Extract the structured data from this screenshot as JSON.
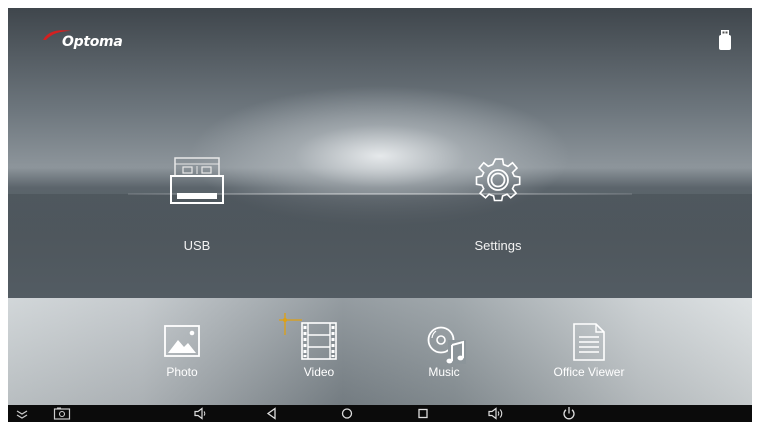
{
  "brand": {
    "logo_text": "Optoma",
    "accent": "#d42020"
  },
  "status": {
    "icon": "usb-drive-icon"
  },
  "main_apps": [
    {
      "label": "USB",
      "icon": "usb-drive-icon"
    },
    {
      "label": "Settings",
      "icon": "gear-icon"
    }
  ],
  "media_apps": [
    {
      "label": "Photo",
      "icon": "photo-icon"
    },
    {
      "label": "Video",
      "icon": "film-strip-icon"
    },
    {
      "label": "Music",
      "icon": "music-disc-icon"
    },
    {
      "label": "Office Viewer",
      "icon": "document-icon"
    }
  ],
  "navbar": {
    "background": "#0b0b0b",
    "buttons": [
      "collapse-icon",
      "screenshot-icon",
      "volume-down-icon",
      "back-icon",
      "home-icon",
      "recents-icon",
      "volume-up-icon",
      "power-icon"
    ]
  },
  "pointer": {
    "color": "#e0a010"
  }
}
